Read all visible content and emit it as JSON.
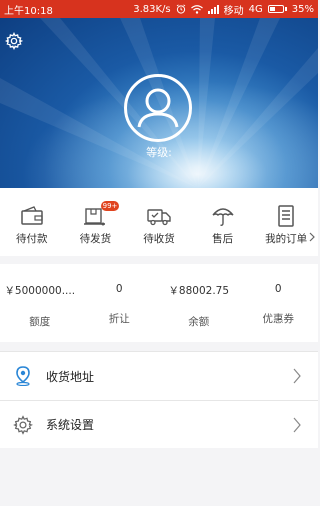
{
  "status_bar": {
    "time": "上午10:18",
    "speed": "3.83K/s",
    "carrier": "移动",
    "network": "4G",
    "battery": "35%",
    "battery_level": 0.35
  },
  "profile": {
    "level_label": "等级:"
  },
  "orders": [
    {
      "label": "待付款",
      "icon": "wallet-icon"
    },
    {
      "label": "待发货",
      "icon": "box-ship-icon",
      "badge": "99+"
    },
    {
      "label": "待收货",
      "icon": "truck-icon"
    },
    {
      "label": "售后",
      "icon": "umbrella-icon"
    },
    {
      "label": "我的订单",
      "icon": "order-list-icon"
    }
  ],
  "stats": [
    {
      "value": "￥5000000....",
      "label": "额度"
    },
    {
      "value": "0",
      "label": "折让"
    },
    {
      "value": "￥88002.75",
      "label": "余额"
    },
    {
      "value": "0",
      "label": "优惠券"
    }
  ],
  "menu": [
    {
      "label": "收货地址",
      "icon": "location-pin-icon"
    },
    {
      "label": "系统设置",
      "icon": "gear-icon"
    }
  ],
  "colors": {
    "status_bar": "#d7331e",
    "accent_blue": "#2a86d6",
    "badge": "#e0441f"
  }
}
